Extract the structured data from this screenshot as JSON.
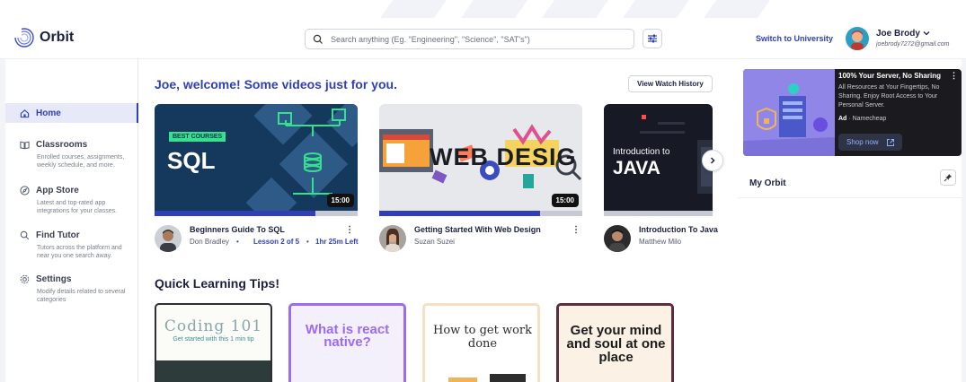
{
  "app": {
    "name": "Orbit"
  },
  "search": {
    "placeholder": "Search anything (Eg. \"Engineering\", \"Science\", \"SAT's\")"
  },
  "header": {
    "switch_label": "Switch to University",
    "user_name": "Joe Brody",
    "user_email": "joebrody7272@gmail.com"
  },
  "sidebar": {
    "items": [
      {
        "label": "Home",
        "icon": "home-icon",
        "desc": ""
      },
      {
        "label": "Classrooms",
        "icon": "book-icon",
        "desc": "Enrolled courses, assignments, weekly schedule, and more."
      },
      {
        "label": "App Store",
        "icon": "compass-icon",
        "desc": "Latest and top-rated app integrations for your classes."
      },
      {
        "label": "Find Tutor",
        "icon": "search-icon",
        "desc": "Tutors across the platform and near you one search away."
      },
      {
        "label": "Settings",
        "icon": "gear-icon",
        "desc": "Modify details related to several categories"
      }
    ]
  },
  "main": {
    "welcome": "Joe, welcome! Some videos just for you.",
    "history_button": "View Watch History",
    "videos": [
      {
        "title": "Beginners Guide To SQL",
        "author": "Don Bradley",
        "lesson": "Lesson 2 of 5",
        "time_left": "1hr 25m Left",
        "duration": "15:00",
        "progress": 0.79,
        "thumb_badge": "BEST COURSES",
        "thumb_text": "SQL"
      },
      {
        "title": "Getting Started With Web Design",
        "author": "Suzan Suzei",
        "duration": "15:00",
        "progress": 0.79,
        "thumb_text": "WEB DESIG"
      },
      {
        "title": "Introduction To Java",
        "author": "Matthew Milo",
        "thumb_line1": "Introduction to",
        "thumb_text": "JAVA"
      }
    ],
    "tips_heading": "Quick Learning Tips!",
    "tips": [
      {
        "title": "Coding 101",
        "subtitle": "Get started with this 1 min tip"
      },
      {
        "title": "What is react native?"
      },
      {
        "title": "How to get work done"
      },
      {
        "title": "Get your mind and soul at one place"
      }
    ]
  },
  "ad": {
    "title": "100% Your Server, No Sharing",
    "body": "All Resources at Your Fingertips, No Sharing. Enjoy Root Access to Your Personal Server.",
    "ad_tag": "Ad",
    "advertiser": "· Namecheap",
    "button": "Shop now"
  },
  "right_panel": {
    "my_orbit": "My Orbit"
  },
  "colors": {
    "accent": "#2f3fb8",
    "sidebar_active_bg": "#e7e9f8"
  }
}
